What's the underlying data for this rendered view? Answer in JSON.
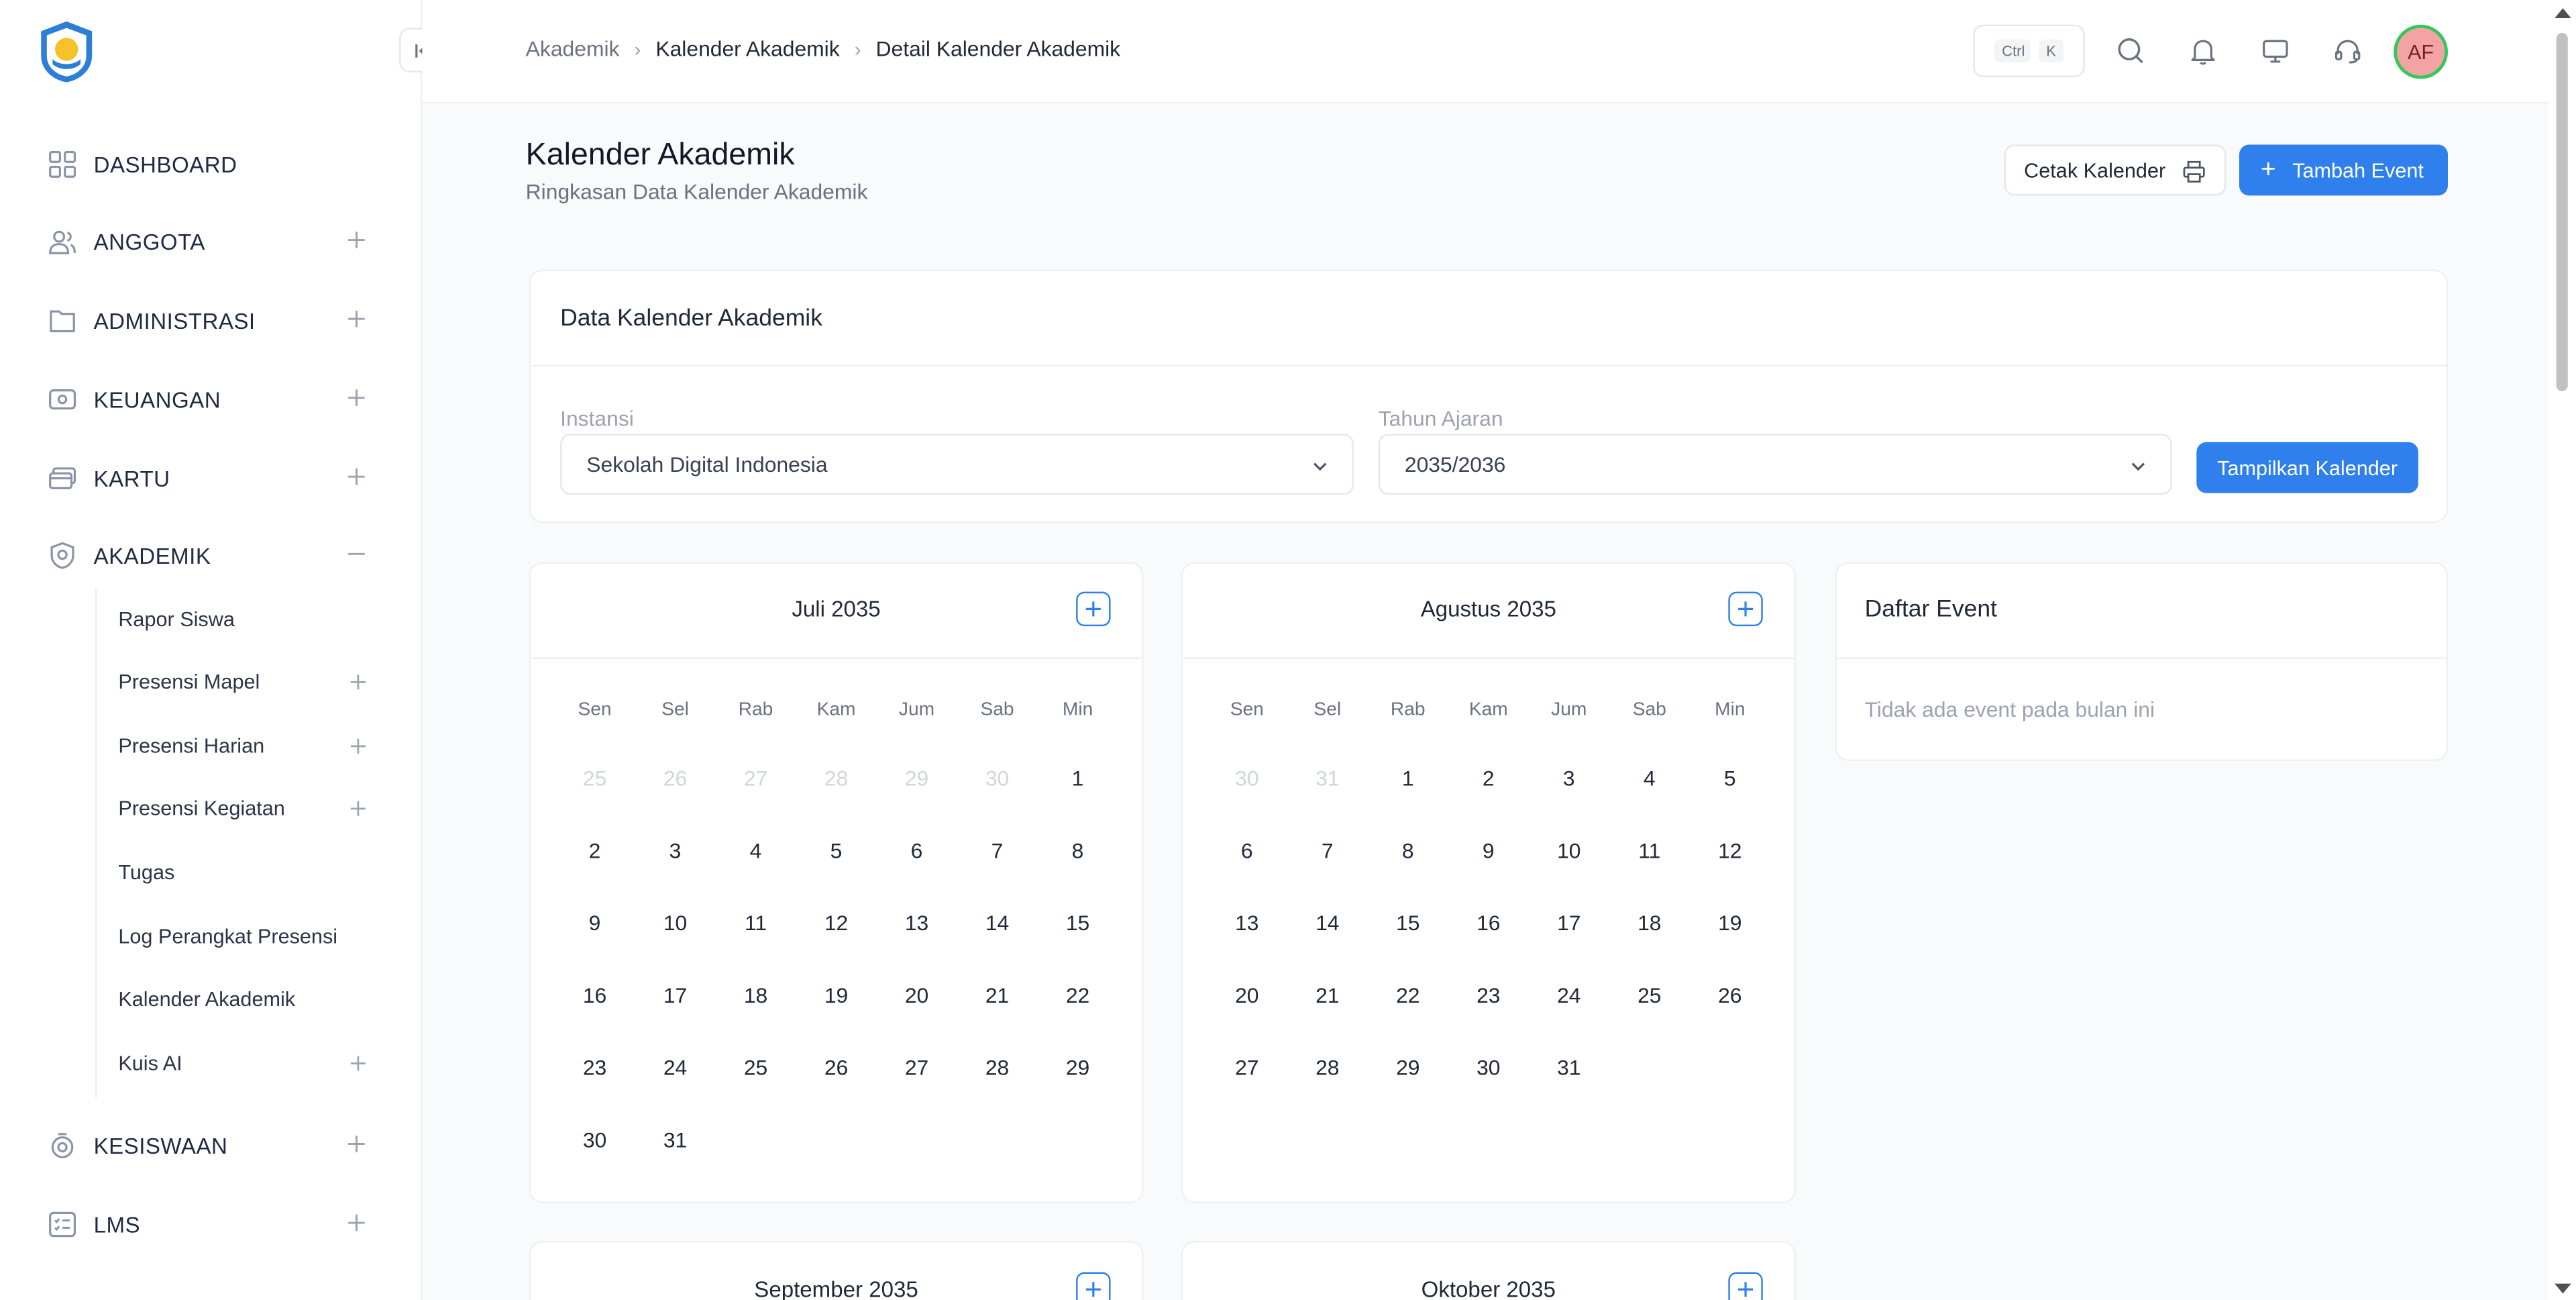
{
  "sidebar": {
    "items": [
      {
        "label": "DASHBOARD",
        "icon": "grid-icon",
        "toggle": ""
      },
      {
        "label": "ANGGOTA",
        "icon": "users-icon",
        "toggle": "+"
      },
      {
        "label": "ADMINISTRASI",
        "icon": "folder-icon",
        "toggle": "+"
      },
      {
        "label": "KEUANGAN",
        "icon": "wallet-icon",
        "toggle": "+"
      },
      {
        "label": "KARTU",
        "icon": "card-icon",
        "toggle": "+"
      },
      {
        "label": "AKADEMIK",
        "icon": "shield-icon",
        "toggle": "−"
      },
      {
        "label": "KESISWAAN",
        "icon": "badge-icon",
        "toggle": "+"
      },
      {
        "label": "LMS",
        "icon": "list-icon",
        "toggle": "+"
      }
    ],
    "akademik_sub": [
      {
        "label": "Rapor Siswa",
        "toggle": ""
      },
      {
        "label": "Presensi Mapel",
        "toggle": "+"
      },
      {
        "label": "Presensi Harian",
        "toggle": "+"
      },
      {
        "label": "Presensi Kegiatan",
        "toggle": "+"
      },
      {
        "label": "Tugas",
        "toggle": ""
      },
      {
        "label": "Log Perangkat Presensi",
        "toggle": ""
      },
      {
        "label": "Kalender Akademik",
        "toggle": ""
      },
      {
        "label": "Kuis AI",
        "toggle": "+"
      }
    ]
  },
  "topbar": {
    "breadcrumb": [
      "Akademik",
      "Kalender Akademik",
      "Detail Kalender Akademik"
    ],
    "shortcut": [
      "Ctrl",
      "K"
    ],
    "avatar_initials": "AF"
  },
  "page": {
    "title": "Kalender Akademik",
    "subtitle": "Ringkasan Data Kalender Akademik",
    "print_label": "Cetak Kalender",
    "add_label": "Tambah Event"
  },
  "filter": {
    "title": "Data Kalender Akademik",
    "instansi_label": "Instansi",
    "instansi_value": "Sekolah Digital Indonesia",
    "tahun_label": "Tahun Ajaran",
    "tahun_value": "2035/2036",
    "show_label": "Tampilkan Kalender"
  },
  "weekdays": [
    "Sen",
    "Sel",
    "Rab",
    "Kam",
    "Jum",
    "Sab",
    "Min"
  ],
  "months": [
    {
      "name": "Juli 2035",
      "weeks": [
        [
          {
            "d": "25",
            "m": 1
          },
          {
            "d": "26",
            "m": 1
          },
          {
            "d": "27",
            "m": 1
          },
          {
            "d": "28",
            "m": 1
          },
          {
            "d": "29",
            "m": 1
          },
          {
            "d": "30",
            "m": 1
          },
          {
            "d": "1",
            "m": 0
          }
        ],
        [
          {
            "d": "2",
            "m": 0
          },
          {
            "d": "3",
            "m": 0
          },
          {
            "d": "4",
            "m": 0
          },
          {
            "d": "5",
            "m": 0
          },
          {
            "d": "6",
            "m": 0
          },
          {
            "d": "7",
            "m": 0
          },
          {
            "d": "8",
            "m": 0
          }
        ],
        [
          {
            "d": "9",
            "m": 0
          },
          {
            "d": "10",
            "m": 0
          },
          {
            "d": "11",
            "m": 0
          },
          {
            "d": "12",
            "m": 0
          },
          {
            "d": "13",
            "m": 0
          },
          {
            "d": "14",
            "m": 0
          },
          {
            "d": "15",
            "m": 0
          }
        ],
        [
          {
            "d": "16",
            "m": 0
          },
          {
            "d": "17",
            "m": 0
          },
          {
            "d": "18",
            "m": 0
          },
          {
            "d": "19",
            "m": 0
          },
          {
            "d": "20",
            "m": 0
          },
          {
            "d": "21",
            "m": 0
          },
          {
            "d": "22",
            "m": 0
          }
        ],
        [
          {
            "d": "23",
            "m": 0
          },
          {
            "d": "24",
            "m": 0
          },
          {
            "d": "25",
            "m": 0
          },
          {
            "d": "26",
            "m": 0
          },
          {
            "d": "27",
            "m": 0
          },
          {
            "d": "28",
            "m": 0
          },
          {
            "d": "29",
            "m": 0
          }
        ],
        [
          {
            "d": "30",
            "m": 0
          },
          {
            "d": "31",
            "m": 0
          }
        ]
      ]
    },
    {
      "name": "Agustus 2035",
      "weeks": [
        [
          {
            "d": "30",
            "m": 1
          },
          {
            "d": "31",
            "m": 1
          },
          {
            "d": "1",
            "m": 0
          },
          {
            "d": "2",
            "m": 0
          },
          {
            "d": "3",
            "m": 0
          },
          {
            "d": "4",
            "m": 0
          },
          {
            "d": "5",
            "m": 0
          }
        ],
        [
          {
            "d": "6",
            "m": 0
          },
          {
            "d": "7",
            "m": 0
          },
          {
            "d": "8",
            "m": 0
          },
          {
            "d": "9",
            "m": 0
          },
          {
            "d": "10",
            "m": 0
          },
          {
            "d": "11",
            "m": 0
          },
          {
            "d": "12",
            "m": 0
          }
        ],
        [
          {
            "d": "13",
            "m": 0
          },
          {
            "d": "14",
            "m": 0
          },
          {
            "d": "15",
            "m": 0
          },
          {
            "d": "16",
            "m": 0
          },
          {
            "d": "17",
            "m": 0
          },
          {
            "d": "18",
            "m": 0
          },
          {
            "d": "19",
            "m": 0
          }
        ],
        [
          {
            "d": "20",
            "m": 0
          },
          {
            "d": "21",
            "m": 0
          },
          {
            "d": "22",
            "m": 0
          },
          {
            "d": "23",
            "m": 0
          },
          {
            "d": "24",
            "m": 0
          },
          {
            "d": "25",
            "m": 0
          },
          {
            "d": "26",
            "m": 0
          }
        ],
        [
          {
            "d": "27",
            "m": 0
          },
          {
            "d": "28",
            "m": 0
          },
          {
            "d": "29",
            "m": 0
          },
          {
            "d": "30",
            "m": 0
          },
          {
            "d": "31",
            "m": 0
          }
        ]
      ]
    }
  ],
  "next_months": [
    "September 2035",
    "Oktober 2035"
  ],
  "events": {
    "title": "Daftar Event",
    "empty_text": "Tidak ada event pada bulan ini"
  },
  "colors": {
    "accent": "#2f80ed",
    "avatar_bg": "#f3a3a3",
    "avatar_ring": "#34c759"
  }
}
